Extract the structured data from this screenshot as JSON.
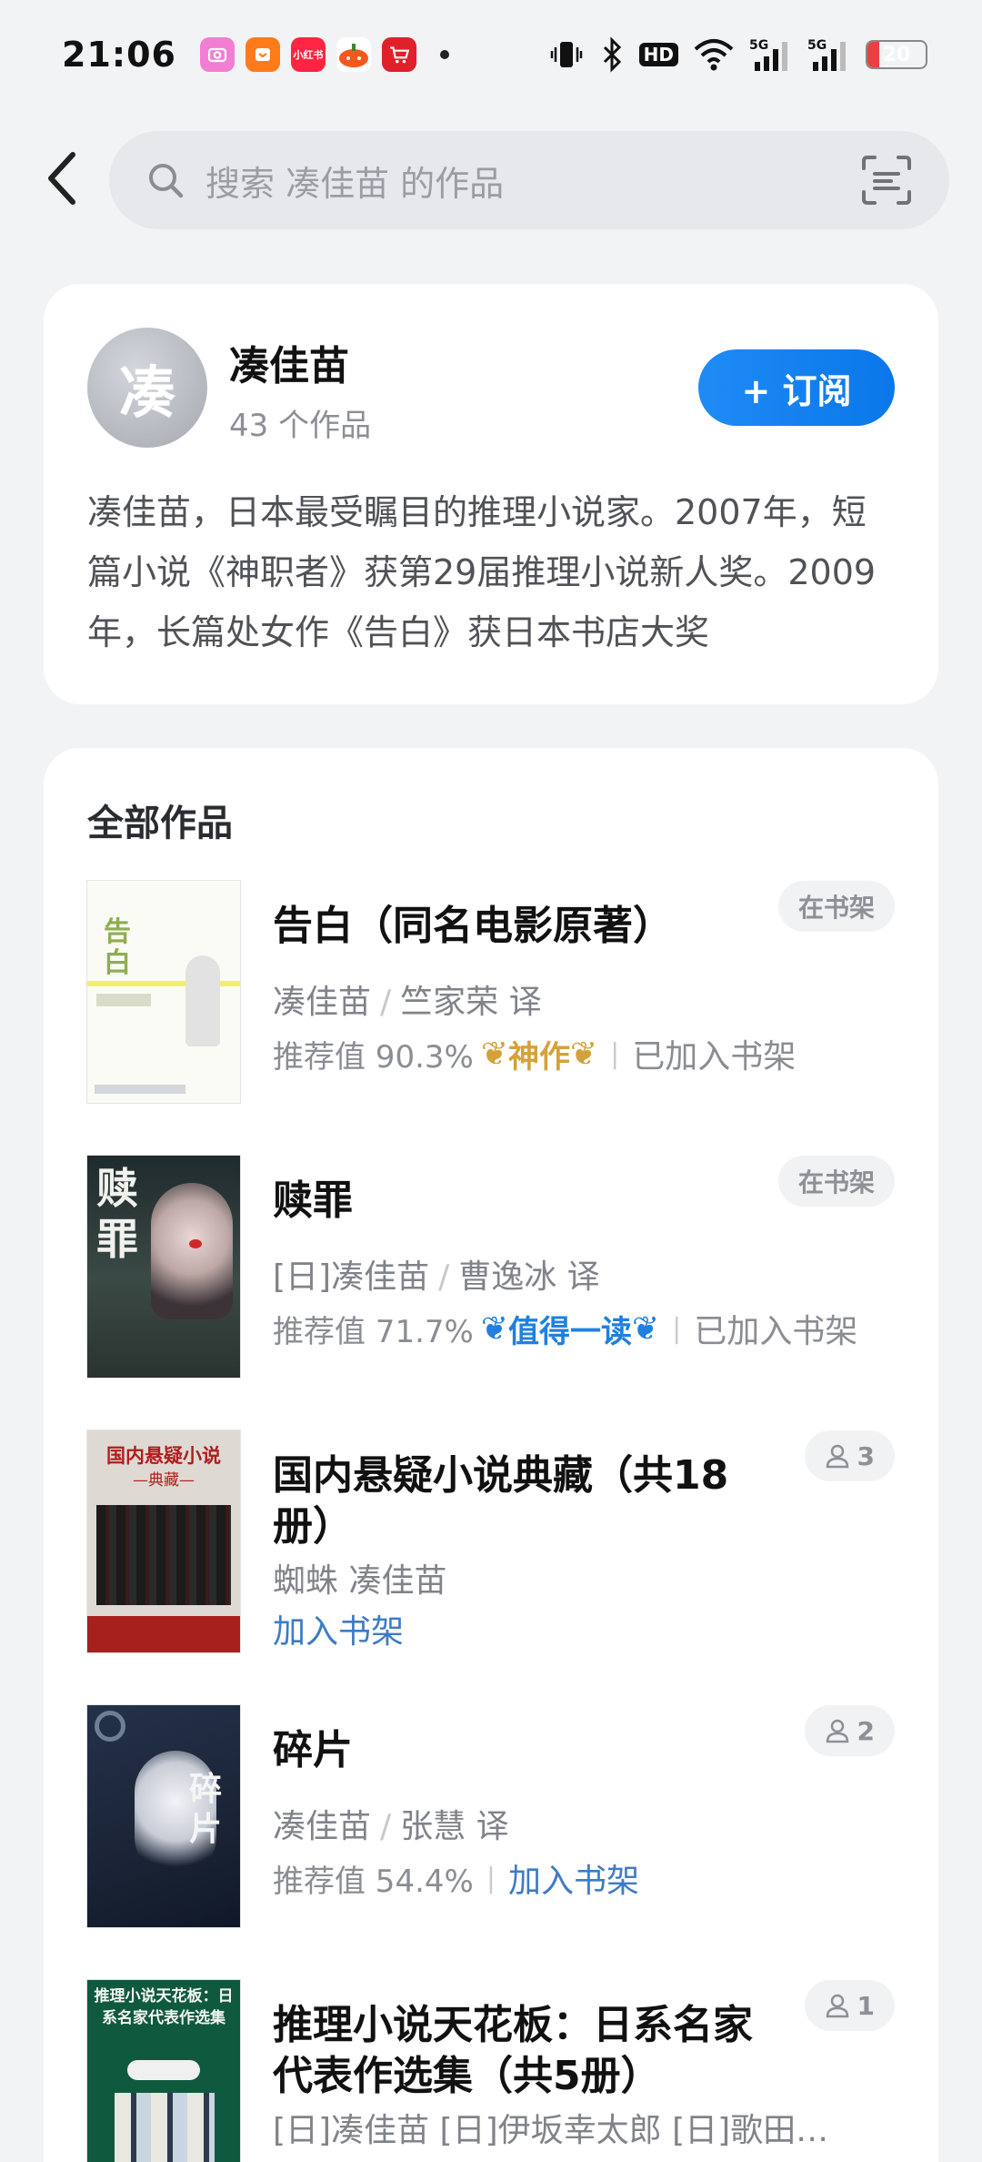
{
  "status_bar": {
    "time": "21:06",
    "notifications": [
      {
        "icon": "camera-app-icon",
        "color": "#f27ed3",
        "text": ""
      },
      {
        "icon": "shopping-app-icon",
        "color": "#ff7a1a",
        "text": ""
      },
      {
        "icon": "xiaohongshu-app-icon",
        "color": "#ff2442",
        "text": "小红书"
      },
      {
        "icon": "pumpkin-app-icon",
        "color": "#f5571d",
        "text": ""
      },
      {
        "icon": "cart-app-icon",
        "color": "#e0202b",
        "text": ""
      }
    ],
    "hd_label": "HD",
    "battery_level": "20",
    "battery_fraction": 0.2
  },
  "search": {
    "placeholder": "搜索 凑佳苗 的作品"
  },
  "author": {
    "avatar_char": "凑",
    "name": "凑佳苗",
    "works_count": "43 个作品",
    "subscribe_label": "+ 订阅",
    "bio": "凑佳苗，日本最受瞩目的推理小说家。2007年，短篇小说《神职者》获第29届推理小说新人奖。2009年，长篇处女作《告白》获日本书店大奖"
  },
  "works": {
    "section_title": "全部作品",
    "books": [
      {
        "title": "告白（同名电影原著）",
        "author": "凑佳苗",
        "translator": "竺家荣 译",
        "recommend": "推荐值 90.3%",
        "badge": "神作",
        "badge_style": "gold",
        "shelf_status": "已加入书架",
        "tag": "在书架",
        "cover_title": "告白"
      },
      {
        "title": "赎罪",
        "author": "[日]凑佳苗",
        "translator": "曹逸冰 译",
        "recommend": "推荐值 71.7%",
        "badge": "值得一读",
        "badge_style": "blue",
        "shelf_status": "已加入书架",
        "tag": "在书架",
        "cover_title": "赎罪"
      },
      {
        "title": "国内悬疑小说典藏（共18册）",
        "author": "蜘蛛  凑佳苗",
        "add_label": "加入书架",
        "tag": "3",
        "cover_title": "国内悬疑小说",
        "cover_sub": "—典藏—"
      },
      {
        "title": "碎片",
        "author": "凑佳苗",
        "translator": "张慧 译",
        "recommend": "推荐值 54.4%",
        "add_label": "加入书架",
        "tag": "2",
        "cover_title": "碎片"
      },
      {
        "title": "推理小说天花板：日系名家代表作选集（共5册）",
        "author": "[日]凑佳苗 [日]伊坂幸太郎 [日]歌田年 [日]东野圭吾",
        "tag": "1",
        "cover_title": "推理小说天花板：日系名家代表作选集"
      }
    ]
  }
}
